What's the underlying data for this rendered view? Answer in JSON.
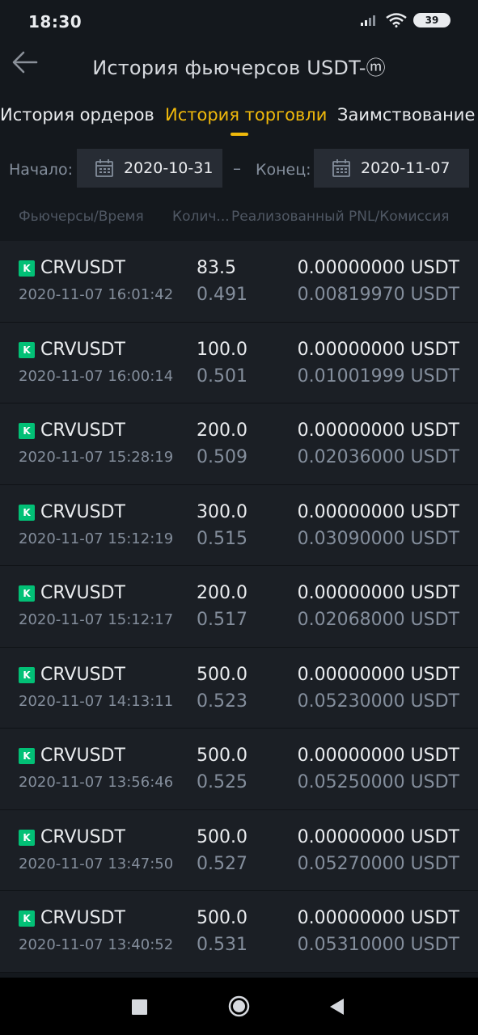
{
  "status_bar": {
    "time": "18:30",
    "battery": "39",
    "icons": [
      "signal-icon",
      "wifi-icon",
      "battery-icon"
    ]
  },
  "header": {
    "title": "История фьючерсов USDT-ⓜ",
    "back_icon": "arrow-left-icon"
  },
  "tabs": [
    {
      "label": "История ордеров",
      "active": false
    },
    {
      "label": "История торговли",
      "active": true
    },
    {
      "label": "Заимствование",
      "active": false
    }
  ],
  "filters": {
    "start_label": "Начало:",
    "start_date": "2020-10-31",
    "separator": "–",
    "end_label": "Конец:",
    "end_date": "2020-11-07",
    "icon": "calendar-icon"
  },
  "columns": {
    "col1": "Фьючерсы/Время",
    "col2": "Колич...",
    "col3": "Реализованный PNL/Комиссия"
  },
  "trades": [
    {
      "badge": "K",
      "symbol": "CRVUSDT",
      "time": "2020-11-07 16:01:42",
      "qty": "83.5",
      "price": "0.491",
      "pnl": "0.00000000 USDT",
      "fee": "0.00819970 USDT"
    },
    {
      "badge": "K",
      "symbol": "CRVUSDT",
      "time": "2020-11-07 16:00:14",
      "qty": "100.0",
      "price": "0.501",
      "pnl": "0.00000000 USDT",
      "fee": "0.01001999 USDT"
    },
    {
      "badge": "K",
      "symbol": "CRVUSDT",
      "time": "2020-11-07 15:28:19",
      "qty": "200.0",
      "price": "0.509",
      "pnl": "0.00000000 USDT",
      "fee": "0.02036000 USDT"
    },
    {
      "badge": "K",
      "symbol": "CRVUSDT",
      "time": "2020-11-07 15:12:19",
      "qty": "300.0",
      "price": "0.515",
      "pnl": "0.00000000 USDT",
      "fee": "0.03090000 USDT"
    },
    {
      "badge": "K",
      "symbol": "CRVUSDT",
      "time": "2020-11-07 15:12:17",
      "qty": "200.0",
      "price": "0.517",
      "pnl": "0.00000000 USDT",
      "fee": "0.02068000 USDT"
    },
    {
      "badge": "K",
      "symbol": "CRVUSDT",
      "time": "2020-11-07 14:13:11",
      "qty": "500.0",
      "price": "0.523",
      "pnl": "0.00000000 USDT",
      "fee": "0.05230000 USDT"
    },
    {
      "badge": "K",
      "symbol": "CRVUSDT",
      "time": "2020-11-07 13:56:46",
      "qty": "500.0",
      "price": "0.525",
      "pnl": "0.00000000 USDT",
      "fee": "0.05250000 USDT"
    },
    {
      "badge": "K",
      "symbol": "CRVUSDT",
      "time": "2020-11-07 13:47:50",
      "qty": "500.0",
      "price": "0.527",
      "pnl": "0.00000000 USDT",
      "fee": "0.05270000 USDT"
    },
    {
      "badge": "K",
      "symbol": "CRVUSDT",
      "time": "2020-11-07 13:40:52",
      "qty": "500.0",
      "price": "0.531",
      "pnl": "0.00000000 USDT",
      "fee": "0.05310000 USDT"
    }
  ],
  "colors": {
    "accent": "#f0b90b",
    "badge": "#02c076",
    "background": "#14181d",
    "row": "#1b1f25"
  },
  "nav_bar": {
    "buttons": [
      "recents-square-icon",
      "home-circle-icon",
      "back-triangle-icon"
    ]
  }
}
